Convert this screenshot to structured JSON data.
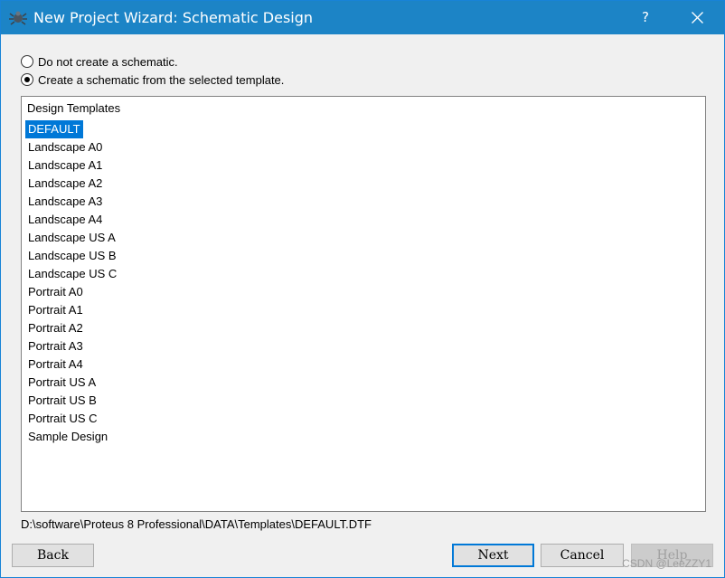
{
  "window": {
    "title": "New Project Wizard: Schematic Design",
    "help_label": "?",
    "accent_color": "#1c84c6"
  },
  "options": [
    {
      "label": "Do not create a schematic.",
      "checked": false
    },
    {
      "label": "Create a schematic from the selected template.",
      "checked": true
    }
  ],
  "templates": {
    "header": "Design Templates",
    "selected_index": 0,
    "items": [
      "DEFAULT",
      "Landscape A0",
      "Landscape A1",
      "Landscape A2",
      "Landscape A3",
      "Landscape A4",
      "Landscape US A",
      "Landscape US B",
      "Landscape US C",
      "Portrait A0",
      "Portrait A1",
      "Portrait A2",
      "Portrait A3",
      "Portrait A4",
      "Portrait US A",
      "Portrait US B",
      "Portrait US C",
      "Sample Design"
    ]
  },
  "template_path": "D:\\software\\Proteus 8 Professional\\DATA\\Templates\\DEFAULT.DTF",
  "buttons": {
    "back": "Back",
    "next": "Next",
    "cancel": "Cancel",
    "help": "Help"
  },
  "watermark": "CSDN @LeeZZY1"
}
